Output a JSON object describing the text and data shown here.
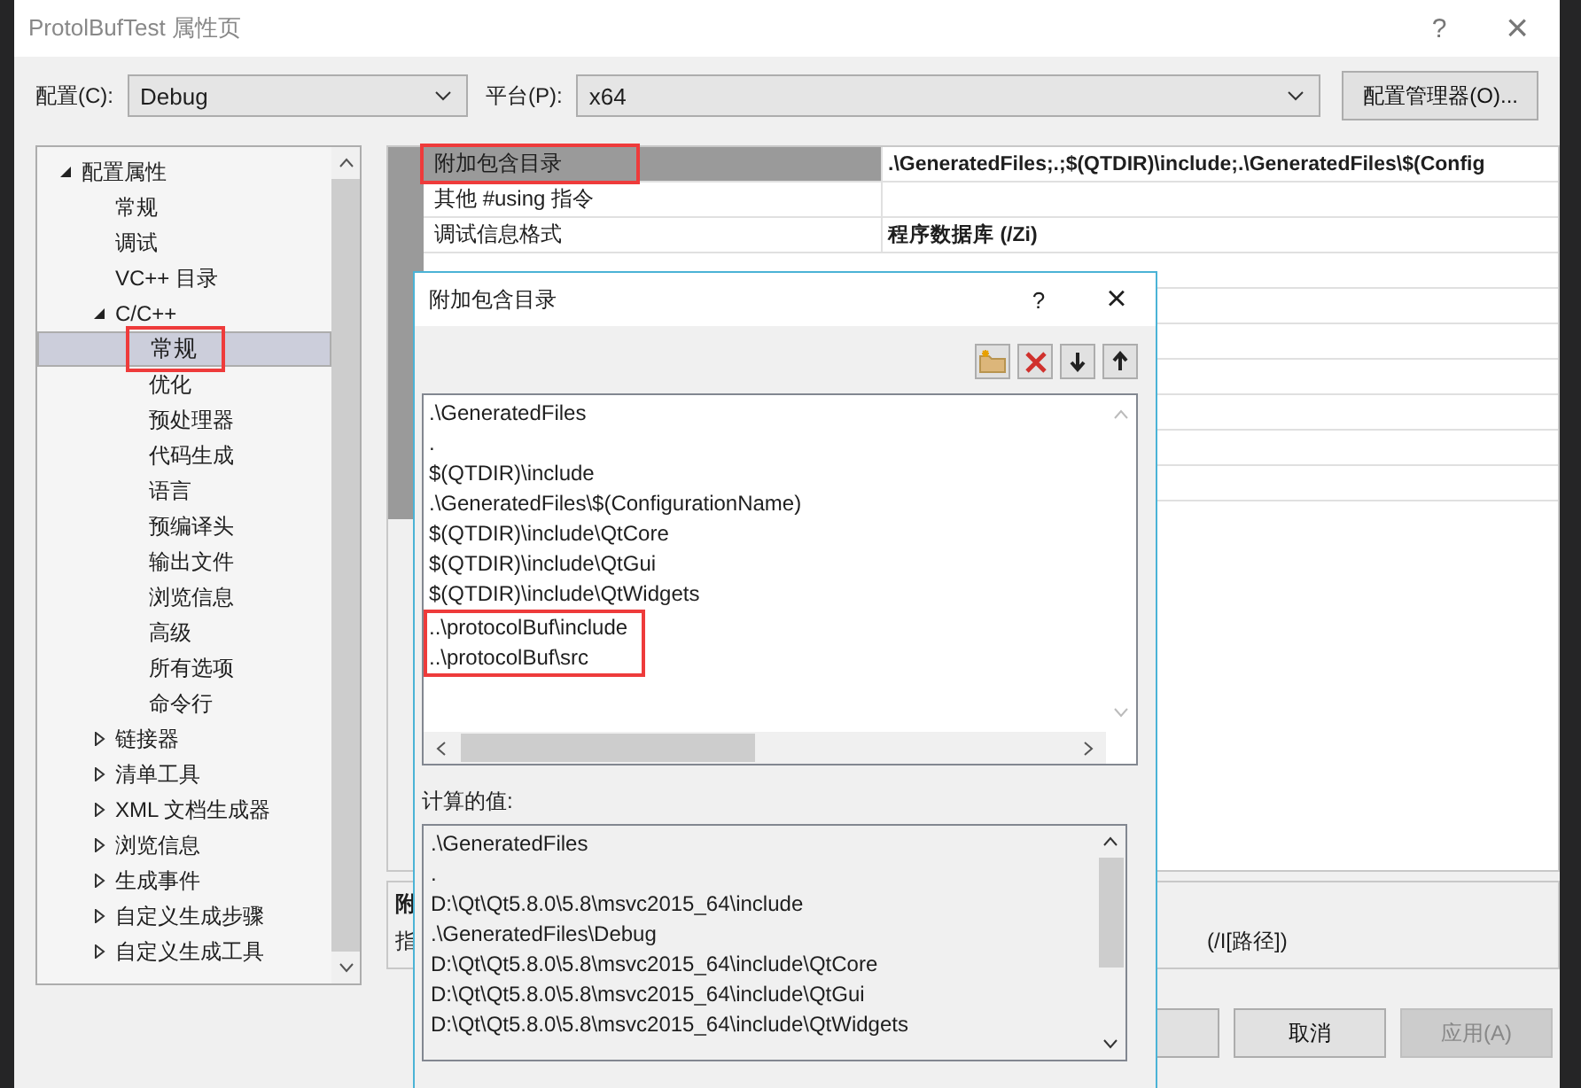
{
  "window": {
    "title": "ProtolBufTest 属性页",
    "help_button": "?",
    "close_button": "×"
  },
  "config_bar": {
    "configuration_label": "配置(C):",
    "configuration": "Debug",
    "platform_label": "平台(P):",
    "platform": "x64",
    "manager_button": "配置管理器(O)..."
  },
  "tree": [
    {
      "label": "配置属性",
      "expanded": true,
      "selected": false,
      "highlighted": false,
      "children": [
        {
          "label": "常规",
          "selected": false,
          "highlighted": false
        },
        {
          "label": "调试",
          "selected": false,
          "highlighted": false
        },
        {
          "label": "VC++ 目录",
          "selected": false,
          "highlighted": false
        },
        {
          "label": "C/C++",
          "expanded": true,
          "selected": false,
          "highlighted": false,
          "children": [
            {
              "label": "常规",
              "selected": true,
              "highlighted": true
            },
            {
              "label": "优化",
              "selected": false,
              "highlighted": false
            },
            {
              "label": "预处理器",
              "selected": false,
              "highlighted": false
            },
            {
              "label": "代码生成",
              "selected": false,
              "highlighted": false
            },
            {
              "label": "语言",
              "selected": false,
              "highlighted": false
            },
            {
              "label": "预编译头",
              "selected": false,
              "highlighted": false
            },
            {
              "label": "输出文件",
              "selected": false,
              "highlighted": false
            },
            {
              "label": "浏览信息",
              "selected": false,
              "highlighted": false
            },
            {
              "label": "高级",
              "selected": false,
              "highlighted": false
            },
            {
              "label": "所有选项",
              "selected": false,
              "highlighted": false
            },
            {
              "label": "命令行",
              "selected": false,
              "highlighted": false
            }
          ]
        },
        {
          "label": "链接器",
          "expanded": false,
          "selected": false,
          "highlighted": false
        },
        {
          "label": "清单工具",
          "expanded": false,
          "selected": false,
          "highlighted": false
        },
        {
          "label": "XML 文档生成器",
          "expanded": false,
          "selected": false,
          "highlighted": false
        },
        {
          "label": "浏览信息",
          "expanded": false,
          "selected": false,
          "highlighted": false
        },
        {
          "label": "生成事件",
          "expanded": false,
          "selected": false,
          "highlighted": false
        },
        {
          "label": "自定义生成步骤",
          "expanded": false,
          "selected": false,
          "highlighted": false
        },
        {
          "label": "自定义生成工具",
          "expanded": false,
          "selected": false,
          "highlighted": false
        }
      ]
    }
  ],
  "properties": [
    {
      "name": "附加包含目录",
      "value": ".\\GeneratedFiles;.;$(QTDIR)\\include;.\\GeneratedFiles\\$(Config",
      "selected": true,
      "highlighted": true
    },
    {
      "name": "其他 #using 指令",
      "selected": false,
      "highlighted": false
    },
    {
      "name": "调试信息格式",
      "value": "程序数据库 (/Zi)",
      "selected": false,
      "highlighted": false
    }
  ],
  "description": {
    "title": "附",
    "text": "指",
    "suffix": "(/I[路径])"
  },
  "buttons": [
    {
      "label": "取消",
      "disabled": false
    },
    {
      "label": "应用(A)",
      "disabled": true
    }
  ],
  "dialog": {
    "title": "附加包含目录",
    "help_button": "?",
    "close_button": "×",
    "entries": [
      {
        "text": ".\\GeneratedFiles",
        "highlighted": false
      },
      {
        "text": ".",
        "highlighted": false
      },
      {
        "text": "$(QTDIR)\\include",
        "highlighted": false
      },
      {
        "text": ".\\GeneratedFiles\\$(ConfigurationName)",
        "highlighted": false
      },
      {
        "text": "$(QTDIR)\\include\\QtCore",
        "highlighted": false
      },
      {
        "text": "$(QTDIR)\\include\\QtGui",
        "highlighted": false
      },
      {
        "text": "$(QTDIR)\\include\\QtWidgets",
        "highlighted": false
      },
      {
        "text": "..\\protocolBuf\\include",
        "highlighted": true
      },
      {
        "text": "..\\protocolBuf\\src",
        "highlighted": true
      }
    ],
    "computed_label": "计算的值:",
    "computed": [
      ".\\GeneratedFiles",
      ".",
      "D:\\Qt\\Qt5.8.0\\5.8\\msvc2015_64\\include",
      ".\\GeneratedFiles\\Debug",
      "D:\\Qt\\Qt5.8.0\\5.8\\msvc2015_64\\include\\QtCore",
      "D:\\Qt\\Qt5.8.0\\5.8\\msvc2015_64\\include\\QtGui",
      "D:\\Qt\\Qt5.8.0\\5.8\\msvc2015_64\\include\\QtWidgets"
    ]
  }
}
